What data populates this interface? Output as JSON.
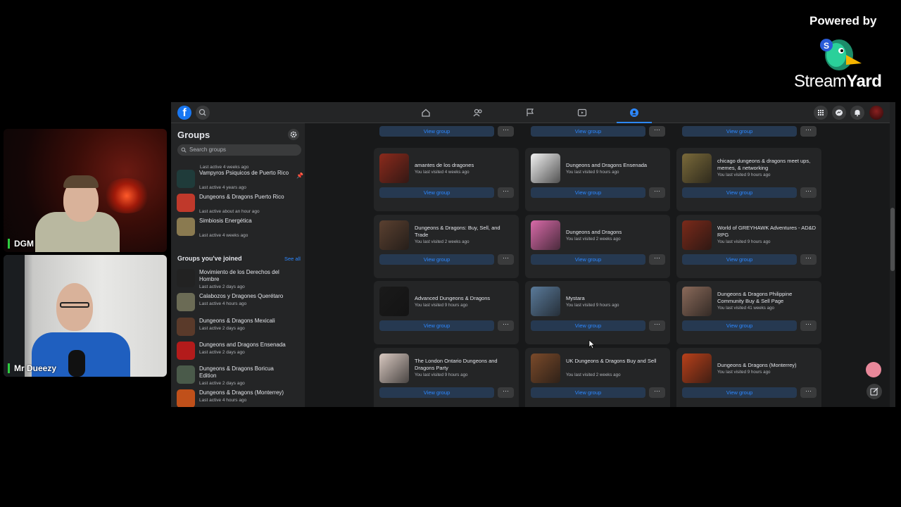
{
  "branding": {
    "powered_by": "Powered by",
    "logo_text_light": "Stream",
    "logo_text_bold": "Yard"
  },
  "cameras": [
    {
      "label": "DGM"
    },
    {
      "label": "Mr Dueezy"
    }
  ],
  "topbar": {
    "logo": "f",
    "nav": [
      "home-icon",
      "friends-icon",
      "pages-icon",
      "watch-icon",
      "groups-icon"
    ],
    "active_nav": "groups-icon",
    "right": [
      "menu-grid-icon",
      "messenger-icon",
      "notifications-icon",
      "account-avatar"
    ]
  },
  "sidebar": {
    "title": "Groups",
    "search_placeholder": "Search groups",
    "top_sub": "Last active 4 weeks ago",
    "items": [
      {
        "name": "Vampyros Psiquicos de Puerto Rico",
        "sub": "Last active 4 years ago",
        "color": "#1f3b3a",
        "pinned": true
      },
      {
        "name": "Dungeons & Dragons Puerto Rico",
        "sub": "Last active about an hour ago",
        "color": "#c0392b"
      },
      {
        "name": "Simbiosis Energética",
        "sub": "Last active 4 weeks ago",
        "color": "#8a7a50"
      }
    ],
    "joined_title": "Groups you've joined",
    "see_all": "See all",
    "joined": [
      {
        "name": "Movimiento de los Derechos del Hombre",
        "sub": "Last active 2 days ago",
        "color": "#222222"
      },
      {
        "name": "Calabozos y Dragones Querétaro",
        "sub": "Last active 4 hours ago",
        "color": "#6b6b55"
      },
      {
        "name": "Dungeons & Dragons Mexicali",
        "sub": "Last active 2 days ago",
        "color": "#5a3a2a"
      },
      {
        "name": "Dungeons and Dragons Ensenada",
        "sub": "Last active 2 days ago",
        "color": "#b31b1b"
      },
      {
        "name": "Dungeons & Dragons Boricua Edition",
        "sub": "Last active 2 days ago",
        "color": "#4a5a4a"
      },
      {
        "name": "Dungeons & Dragons (Monterrey)",
        "sub": "Last active 4 hours ago",
        "color": "#c0501a"
      }
    ]
  },
  "cards": {
    "view_label": "View group",
    "more_label": "···",
    "rows": [
      [
        {
          "name": "amantes de los dragones",
          "sub": "You last visited 4 weeks ago",
          "color": "#8b2a1c"
        },
        {
          "name": "Dungeons and Dragons Ensenada",
          "sub": "You last visited 9 hours ago",
          "color": "#f2f2f2"
        },
        {
          "name": "chicago dungeons & dragons meet ups, memes, & networking",
          "sub": "You last visited 9 hours ago",
          "color": "#7a6a3a"
        }
      ],
      [
        {
          "name": "Dungeons & Dragons: Buy, Sell, and Trade",
          "sub": "You last visited 2 weeks ago",
          "color": "#5a4030"
        },
        {
          "name": "Dungeons and Dragons",
          "sub": "You last visited 2 weeks ago",
          "color": "#d86aa8"
        },
        {
          "name": "World of GREYHAWK Adventures - AD&D RPG",
          "sub": "You last visited 9 hours ago",
          "color": "#7a2a1a"
        }
      ],
      [
        {
          "name": "Advanced Dungeons & Dragons",
          "sub": "You last visited 9 hours ago",
          "color": "#1a1a1a"
        },
        {
          "name": "Mystara",
          "sub": "You last visited 9 hours ago",
          "color": "#5a7a9a"
        },
        {
          "name": "Dungeons & Dragons Philippine Community Buy & Sell Page",
          "sub": "You last visited 41 weeks ago",
          "color": "#8a6a5a"
        }
      ],
      [
        {
          "name": "The London Ontario Dungeons and Dragons Party",
          "sub": "You last visited 9 hours ago",
          "color": "#d8c8c0"
        },
        {
          "name": "UK Dungeons & Dragons Buy and Sell",
          "sub": "You last visited 2 weeks ago",
          "color": "#7a4a2a"
        },
        {
          "name": "Dungeons & Dragons (Monterrey)",
          "sub": "You last visited 9 hours ago",
          "color": "#b8401a"
        }
      ]
    ]
  }
}
